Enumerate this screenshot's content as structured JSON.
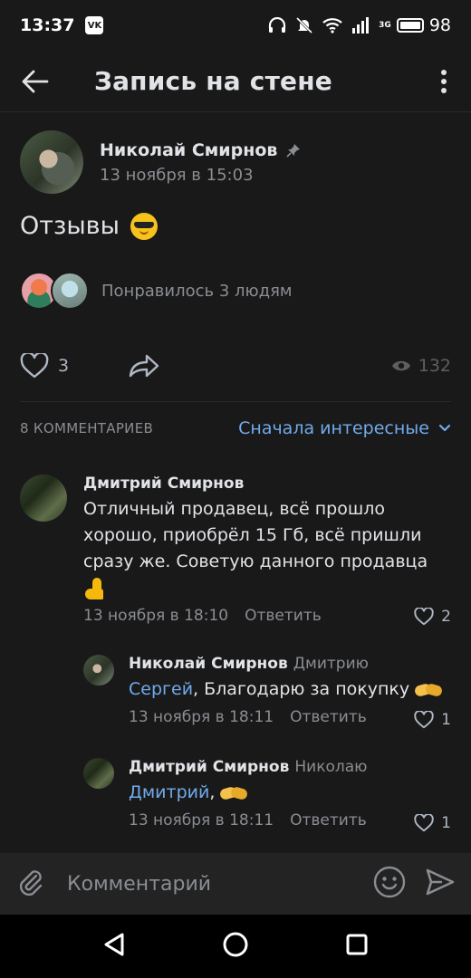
{
  "status_bar": {
    "time": "13:37",
    "network": "3G",
    "battery": "98"
  },
  "header": {
    "title": "Запись на стене"
  },
  "post": {
    "author": "Николай Смирнов",
    "time": "13 ноября в 15:03",
    "text": "Отзывы",
    "likes_text": "Понравилось 3 людям",
    "like_count": "3",
    "views": "132"
  },
  "comments_section": {
    "count_label": "8 КОММЕНТАРИЕВ",
    "sort_label": "Сначала интересные"
  },
  "comments": [
    {
      "name": "Дмитрий Смирнов",
      "text": "Отличный продавец, всё прошло хорошо, приобрёл 15 Гб, всё пришли сразу же. Советую данного продавца",
      "time": "13 ноября в 18:10",
      "reply_label": "Ответить",
      "likes": "2"
    },
    {
      "name": "Николай Смирнов",
      "reply_to": "Дмитрию",
      "mention": "Сергей",
      "text": ", Благодарю за покупку",
      "time": "13 ноября в 18:11",
      "reply_label": "Ответить",
      "likes": "1"
    },
    {
      "name": "Дмитрий Смирнов",
      "reply_to": "Николаю",
      "mention": "Дмитрий",
      "text": ",",
      "time": "13 ноября в 18:11",
      "reply_label": "Ответить",
      "likes": "1"
    }
  ],
  "composer": {
    "placeholder": "Комментарий"
  },
  "colors": {
    "background": "#19191a",
    "accent": "#71aaeb",
    "secondary_text": "#8a8d91",
    "primary_text": "#e1e3e6"
  }
}
